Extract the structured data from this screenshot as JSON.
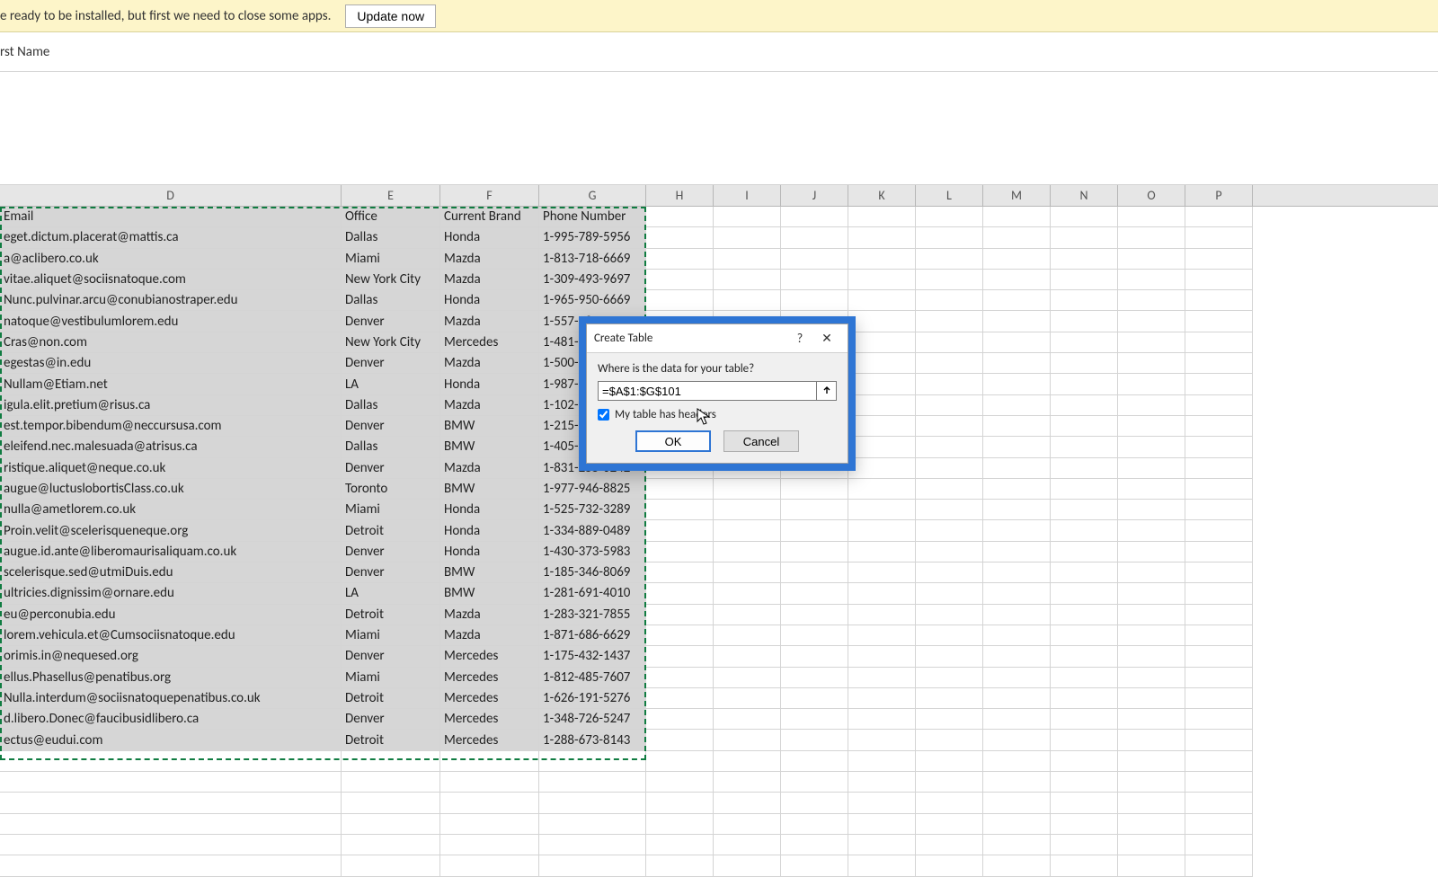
{
  "update_bar": {
    "message": "e ready to be installed, but first we need to close some apps.",
    "button": "Update now"
  },
  "formula_bar": {
    "value": "rst Name"
  },
  "columns": {
    "visible": [
      "D",
      "E",
      "F",
      "G",
      "H",
      "I",
      "J",
      "K",
      "L",
      "M",
      "N",
      "O",
      "P"
    ]
  },
  "table": {
    "headers": [
      "Email",
      "Office",
      "Current Brand",
      "Phone Number"
    ],
    "rows": [
      [
        "eget.dictum.placerat@mattis.ca",
        "Dallas",
        "Honda",
        "1-995-789-5956"
      ],
      [
        "a@aclibero.co.uk",
        "Miami",
        "Mazda",
        "1-813-718-6669"
      ],
      [
        "vitae.aliquet@sociisnatoque.com",
        "New York City",
        "Mazda",
        "1-309-493-9697"
      ],
      [
        "Nunc.pulvinar.arcu@conubianostraper.edu",
        "Dallas",
        "Honda",
        "1-965-950-6669"
      ],
      [
        "natoque@vestibulumlorem.edu",
        "Denver",
        "Mazda",
        "1-557-280-1025"
      ],
      [
        "Cras@non.com",
        "New York City",
        "Mercedes",
        "1-481-185"
      ],
      [
        "egestas@in.edu",
        "Denver",
        "Mazda",
        "1-500-672"
      ],
      [
        "Nullam@Etiam.net",
        "LA",
        "Honda",
        "1-987-286"
      ],
      [
        "igula.elit.pretium@risus.ca",
        "Dallas",
        "Mazda",
        "1-102-318"
      ],
      [
        "est.tempor.bibendum@neccursusa.com",
        "Denver",
        "BMW",
        "1-215-699"
      ],
      [
        "eleifend.nec.malesuada@atrisus.ca",
        "Dallas",
        "BMW",
        "1-405-998"
      ],
      [
        "ristique.aliquet@neque.co.uk",
        "Denver",
        "Mazda",
        "1-831-255-0242"
      ],
      [
        "augue@luctuslobortisClass.co.uk",
        "Toronto",
        "BMW",
        "1-977-946-8825"
      ],
      [
        "nulla@ametlorem.co.uk",
        "Miami",
        "Honda",
        "1-525-732-3289"
      ],
      [
        "Proin.velit@scelerisqueneque.org",
        "Detroit",
        "Honda",
        "1-334-889-0489"
      ],
      [
        "augue.id.ante@liberomaurisaliquam.co.uk",
        "Denver",
        "Honda",
        "1-430-373-5983"
      ],
      [
        "scelerisque.sed@utmiDuis.edu",
        "Denver",
        "BMW",
        "1-185-346-8069"
      ],
      [
        "ultricies.dignissim@ornare.edu",
        "LA",
        "BMW",
        "1-281-691-4010"
      ],
      [
        "eu@perconubia.edu",
        "Detroit",
        "Mazda",
        "1-283-321-7855"
      ],
      [
        "lorem.vehicula.et@Cumsociisnatoque.edu",
        "Miami",
        "Mazda",
        "1-871-686-6629"
      ],
      [
        "orimis.in@nequesed.org",
        "Denver",
        "Mercedes",
        "1-175-432-1437"
      ],
      [
        "ellus.Phasellus@penatibus.org",
        "Miami",
        "Mercedes",
        "1-812-485-7607"
      ],
      [
        "Nulla.interdum@sociisnatoquepenatibus.co.uk",
        "Detroit",
        "Mercedes",
        "1-626-191-5276"
      ],
      [
        "d.libero.Donec@faucibusidlibero.ca",
        "Denver",
        "Mercedes",
        "1-348-726-5247"
      ],
      [
        "ectus@eudui.com",
        "Detroit",
        "Mercedes",
        "1-288-673-8143"
      ]
    ]
  },
  "dialog": {
    "title": "Create Table",
    "prompt": "Where is the data for your table?",
    "range": "=$A$1:$G$101",
    "headers_label": "My table has headers",
    "headers_checked": true,
    "ok": "OK",
    "cancel": "Cancel"
  }
}
